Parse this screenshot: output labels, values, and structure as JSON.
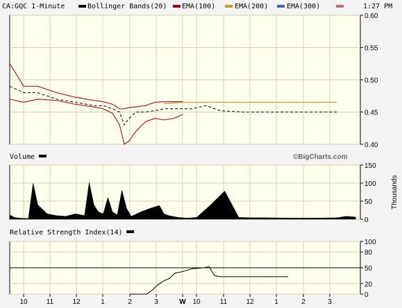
{
  "header": {
    "symbol_label": "CA:GQC 1-Minute",
    "legend": [
      {
        "label": "Bollinger Bands(20)",
        "color": "#000000"
      },
      {
        "label": "EMA(100)",
        "color": "#a00000"
      },
      {
        "label": "EMA(200)",
        "color": "#cc9933"
      },
      {
        "label": "EMA(300)",
        "color": "#3366cc"
      }
    ],
    "time": "1:27 PM"
  },
  "panels": {
    "volume_title": "Volume",
    "volume_unit": "Thousands",
    "rsi_title": "Relative Strength Index(14)",
    "watermark": "©BigCharts.com"
  },
  "colors": {
    "plot_bg": "#ffffee",
    "grid": "#d0d0b0",
    "bands": "#b02020",
    "ema200": "#cc9933",
    "price": "#000000"
  },
  "chart_data": [
    {
      "type": "line",
      "title": "CA:GQC 1-Minute",
      "ylim": [
        0.4,
        0.6
      ],
      "y_ticks": [
        "0.60",
        "0.55",
        "0.50",
        "0.45",
        "0.40"
      ],
      "x": [
        0,
        0.3,
        0.6,
        1.0,
        1.4,
        1.8,
        2.0,
        2.2,
        2.35,
        2.45,
        2.55,
        2.7,
        2.9,
        3.1,
        3.3,
        3.5,
        3.7,
        3.9,
        4.2,
        4.5,
        5.0,
        5.5,
        6.0,
        6.5,
        7.0,
        7.5
      ],
      "series": [
        {
          "name": "Upper band",
          "values": [
            0.525,
            0.49,
            0.49,
            0.48,
            0.473,
            0.468,
            0.466,
            0.462,
            0.455,
            0.455,
            0.457,
            0.458,
            0.46,
            0.465,
            0.466,
            0.466,
            0.466,
            null,
            null,
            null,
            null,
            null,
            null,
            null,
            null,
            null
          ]
        },
        {
          "name": "Lower band",
          "values": [
            0.47,
            0.465,
            0.47,
            0.468,
            0.462,
            0.458,
            0.455,
            0.448,
            0.43,
            0.4,
            0.405,
            0.42,
            0.435,
            0.44,
            0.438,
            0.44,
            0.446,
            null,
            null,
            null,
            null,
            null,
            null,
            null,
            null,
            null
          ]
        },
        {
          "name": "EMA(200)",
          "values": [
            null,
            null,
            null,
            null,
            null,
            null,
            null,
            null,
            null,
            null,
            null,
            null,
            null,
            null,
            0.463,
            0.464,
            0.465,
            0.465,
            0.465,
            0.465,
            0.465,
            0.465,
            0.465,
            0.465,
            0.465,
            null
          ]
        },
        {
          "name": "Price",
          "values": [
            0.49,
            0.48,
            0.48,
            0.47,
            0.465,
            0.46,
            0.46,
            0.455,
            0.45,
            0.43,
            0.44,
            0.45,
            0.45,
            0.452,
            0.455,
            0.455,
            0.455,
            0.455,
            0.46,
            0.452,
            0.45,
            0.45,
            0.45,
            0.45,
            0.45,
            null
          ]
        }
      ]
    },
    {
      "type": "area",
      "title": "Volume",
      "ylabel": "Thousands",
      "ylim": [
        0,
        150
      ],
      "y_ticks": [
        "150",
        "100",
        "50",
        "0"
      ],
      "x": [
        0,
        0.1,
        0.2,
        0.4,
        0.5,
        0.6,
        0.8,
        1.0,
        1.2,
        1.4,
        1.6,
        1.7,
        1.8,
        1.9,
        2.0,
        2.1,
        2.2,
        2.3,
        2.4,
        2.5,
        2.6,
        2.8,
        3.0,
        3.2,
        3.3,
        3.4,
        3.6,
        3.8,
        4.0,
        4.3,
        4.6,
        4.9,
        5.2,
        5.5,
        6.0,
        6.5,
        7.0,
        7.2,
        7.4
      ],
      "values": [
        12,
        5,
        3,
        2,
        100,
        40,
        15,
        10,
        8,
        15,
        10,
        102,
        40,
        20,
        15,
        60,
        20,
        12,
        80,
        30,
        8,
        20,
        30,
        38,
        15,
        10,
        5,
        3,
        5,
        40,
        78,
        5,
        4,
        4,
        3,
        3,
        4,
        8,
        6
      ]
    },
    {
      "type": "line",
      "title": "Relative Strength Index(14)",
      "ylim": [
        0,
        100
      ],
      "y_ticks": [
        "100",
        "80",
        "50",
        "20",
        "0"
      ],
      "x": [
        0,
        1,
        2,
        3,
        4,
        5,
        6,
        7,
        8,
        9,
        10,
        11,
        12,
        13,
        14,
        15,
        16,
        17,
        18,
        19,
        20,
        21,
        22,
        23,
        24,
        25,
        26,
        27,
        28
      ],
      "values": [
        0,
        0,
        0,
        0,
        8,
        18,
        25,
        30,
        40,
        42,
        45,
        48,
        49,
        50,
        52,
        35,
        33,
        33,
        33,
        33,
        33,
        33,
        33,
        33,
        33,
        33,
        33,
        33,
        33
      ]
    }
  ],
  "x_axis": {
    "ticks": [
      "10",
      "11",
      "12",
      "1",
      "2",
      "3",
      "W",
      "10",
      "11",
      "12",
      "1",
      "2",
      "3"
    ]
  },
  "reference_lines": {
    "rsi_50": "50"
  }
}
